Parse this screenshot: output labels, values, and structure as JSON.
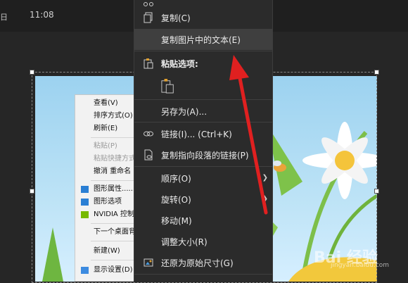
{
  "topbar": {
    "day": "日",
    "time": "11:08"
  },
  "desktop_menu": {
    "items": [
      {
        "label": "查看(V)",
        "disabled": false
      },
      {
        "label": "排序方式(O)",
        "disabled": false
      },
      {
        "label": "刷新(E)",
        "disabled": false
      },
      {
        "label": "粘贴(P)",
        "disabled": true
      },
      {
        "label": "粘贴快捷方式",
        "disabled": true
      },
      {
        "label": "撤消 重命名",
        "disabled": false
      },
      {
        "label": "图形属性......",
        "disabled": false,
        "icon": "intel-graphics-icon"
      },
      {
        "label": "图形选项",
        "disabled": false,
        "icon": "intel-graphics-icon"
      },
      {
        "label": "NVIDIA 控制",
        "disabled": false,
        "icon": "nvidia-icon"
      },
      {
        "label": "下一个桌面背",
        "disabled": false
      },
      {
        "label": "新建(W)",
        "disabled": false
      },
      {
        "label": "显示设置(D)",
        "disabled": false,
        "icon": "display-icon"
      }
    ]
  },
  "context_menu": {
    "copy": "复制(C)",
    "copy_image_text": "复制图片中的文本(E)",
    "paste_options": "粘贴选项:",
    "save_as": "另存为(A)...",
    "link": "链接(I)...  (Ctrl+K)",
    "copy_paragraph_link": "复制指向段落的链接(P)",
    "order": "顺序(O)",
    "rotate": "旋转(O)",
    "move": "移动(M)",
    "resize": "调整大小(R)",
    "reset_size": "还原为原始尺寸(G)"
  },
  "watermark": {
    "main": "Bai 经验",
    "sub": "jingyan.baidu.com"
  },
  "colors": {
    "menu_bg": "#2b2b2b",
    "highlight": "#3f3f3f",
    "arrow_red": "#e02020"
  }
}
